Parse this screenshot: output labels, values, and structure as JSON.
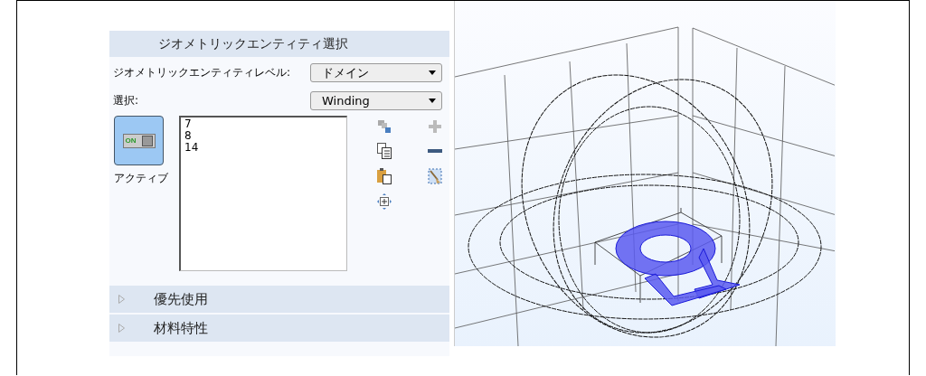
{
  "section": {
    "title": "ジオメトリックエンティティ選択",
    "level_label": "ジオメトリックエンティティレベル:",
    "level_value": "ドメイン",
    "selection_label": "選択:",
    "selection_value": "Winding",
    "active_toggle": {
      "on_text": "ON",
      "on": true,
      "label": "アクティブ"
    },
    "list_items": [
      "7",
      "8",
      "14"
    ]
  },
  "collapsed_sections": [
    {
      "title": "優先使用",
      "expanded": false
    },
    {
      "title": "材料特性",
      "expanded": false
    }
  ]
}
